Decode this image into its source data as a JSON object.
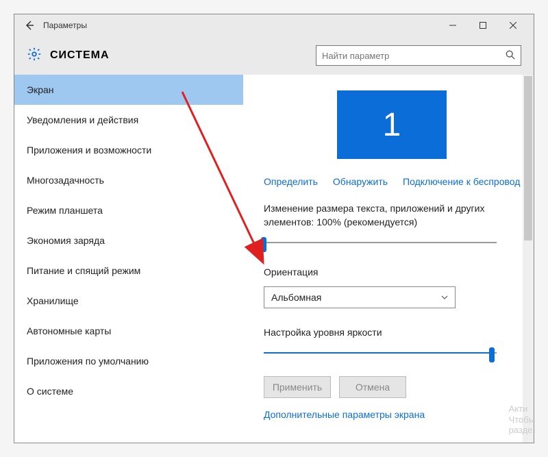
{
  "titlebar": {
    "title": "Параметры"
  },
  "header": {
    "section": "СИСТЕМА"
  },
  "search": {
    "placeholder": "Найти параметр"
  },
  "sidebar": {
    "items": [
      {
        "label": "Экран",
        "selected": true
      },
      {
        "label": "Уведомления и действия"
      },
      {
        "label": "Приложения и возможности"
      },
      {
        "label": "Многозадачность"
      },
      {
        "label": "Режим планшета"
      },
      {
        "label": "Экономия заряда"
      },
      {
        "label": "Питание и спящий режим"
      },
      {
        "label": "Хранилище"
      },
      {
        "label": "Автономные карты"
      },
      {
        "label": "Приложения по умолчанию"
      },
      {
        "label": "О системе"
      }
    ]
  },
  "content": {
    "monitor_number": "1",
    "links": {
      "detect": "Определить",
      "identify": "Обнаружить",
      "wireless": "Подключение к беспровод"
    },
    "scale_label": "Изменение размера текста, приложений и других элементов: 100% (рекомендуется)",
    "orientation_label": "Ориентация",
    "orientation_value": "Альбомная",
    "brightness_label": "Настройка уровня яркости",
    "apply": "Применить",
    "cancel": "Отмена",
    "advanced": "Дополнительные параметры экрана"
  },
  "watermark": {
    "line1": "Акти",
    "line2": "Чтобь",
    "line3": "разде."
  },
  "colors": {
    "accent": "#0a6dd8"
  }
}
